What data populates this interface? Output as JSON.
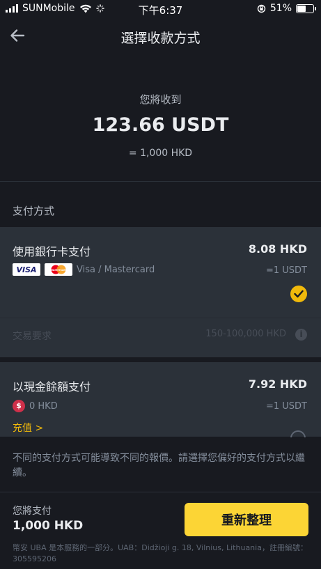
{
  "status_bar": {
    "carrier": "SUNMobile",
    "time": "下午6:37",
    "battery": "51%"
  },
  "header": {
    "title": "選擇收款方式"
  },
  "receive": {
    "label": "您將收到",
    "amount": "123.66 USDT",
    "converted": "= 1,000 HKD"
  },
  "payment_section": {
    "title": "支付方式"
  },
  "methods": [
    {
      "name": "使用銀行卡支付",
      "price": "8.08 HKD",
      "logos": [
        "VISA",
        "Mastercard"
      ],
      "sub_label": "Visa / Mastercard",
      "rate": "=1 USDT",
      "selected": true,
      "requirement_label": "交易要求",
      "requirement_range": "150-100,000 HKD"
    },
    {
      "name": "以現金餘額支付",
      "price": "7.92 HKD",
      "icon_symbol": "$",
      "sub_label": "0 HKD",
      "rate": "=1 USDT",
      "top_up": "充值 >",
      "selected": false
    }
  ],
  "notice": {
    "text": "不同的支付方式可能導致不同的報價。請選擇您偏好的支付方式以繼續。"
  },
  "footer": {
    "pay_label": "您將支付",
    "pay_amount": "1,000 HKD",
    "button": "重新整理",
    "legal": "幣安 UBA 是本服務的一部分。UAB：Didžioji g. 18, Vilnius, Lithuania，註冊編號：305595206"
  },
  "colors": {
    "accent": "#fcd535",
    "background": "#181a20",
    "card": "#2b3139",
    "danger": "#cf304a"
  }
}
